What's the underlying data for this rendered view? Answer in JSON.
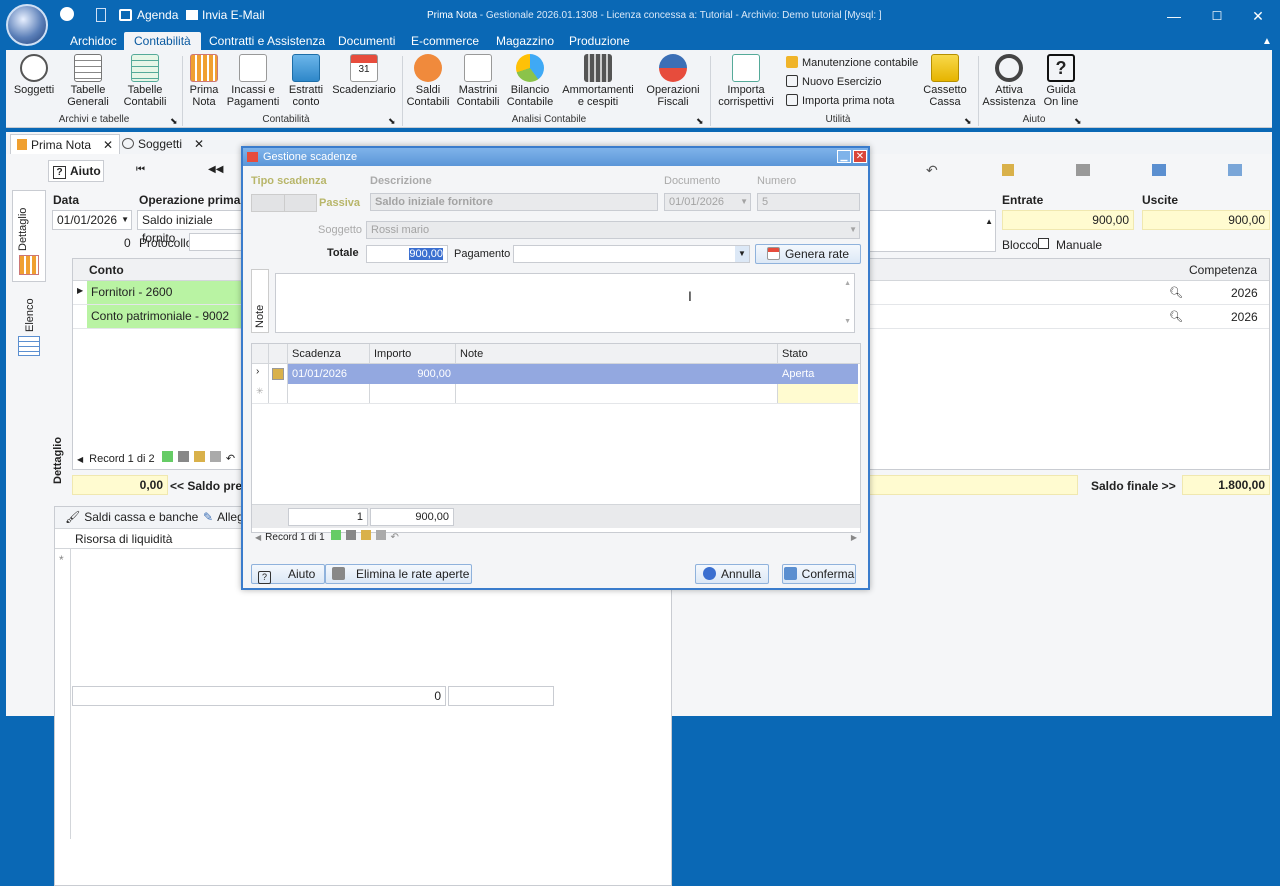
{
  "app": {
    "window_title_main": "Prima Nota",
    "window_title_rest": " - Gestionale 2026.01.1308 - Licenza concessa a: Tutorial - Archivio: Demo tutorial  [Mysql: ]",
    "quick_access": [
      "Agenda",
      "Invia E-Mail"
    ]
  },
  "menu_tabs": [
    "Archidoc",
    "Contabilità",
    "Contratti e Assistenza",
    "Documenti",
    "E-commerce",
    "Magazzino",
    "Produzione"
  ],
  "ribbon": {
    "soggetti": "Soggetti",
    "tabelle_generali": "Tabelle\nGenerali",
    "tabelle_contabili": "Tabelle\nContabili",
    "prima_nota": "Prima\nNota",
    "incassi_pagamenti": "Incassi e\nPagamenti",
    "estratti_conto": "Estratti\nconto",
    "scadenziario": "Scadenziario",
    "saldi_contabili": "Saldi\nContabili",
    "mastrini_contabili": "Mastrini\nContabili",
    "bilancio_contabile": "Bilancio\nContabile",
    "ammortamenti": "Ammortamenti\ne cespiti",
    "operazioni_fiscali": "Operazioni\nFiscali",
    "importa_corrispettivi": "Importa\ncorrispettivi",
    "manutenzione_contabile": "Manutenzione contabile",
    "nuovo_esercizio": "Nuovo Esercizio",
    "importa_prima_nota": "Importa prima nota",
    "cassetto_cassa": "Cassetto\nCassa",
    "attiva_assistenza": "Attiva\nAssistenza",
    "guida_online": "Guida\nOn line",
    "groups": [
      "Archivi e tabelle",
      "Contabilità",
      "Analisi Contabile",
      "Utilità",
      "Aiuto"
    ]
  },
  "doc_tabs": [
    "Prima Nota",
    "Soggetti"
  ],
  "main": {
    "aiuto": "Aiuto",
    "side_tabs": [
      "Dettaglio",
      "Elenco"
    ],
    "data_label": "Data",
    "data_value": "01/01/2026",
    "operazione_label": "Operazione prima n",
    "operazione_value": "Saldo iniziale fornito",
    "zero": "0",
    "protocollo_label": "Protocollo",
    "entrate_label": "Entrate",
    "uscite_label": "Uscite",
    "entrate_value": "900,00",
    "uscite_value": "900,00",
    "blocco_label": "Blocco",
    "manuale_label": "Manuale",
    "conto_header": "Conto",
    "competenza_header": "Competenza",
    "rows": [
      {
        "conto": "Fornitori - 2600",
        "competenza": "2026"
      },
      {
        "conto": "Conto patrimoniale - 9002",
        "competenza": "2026"
      }
    ],
    "dettaglio_vertical": "Dettaglio",
    "record_label": "Record 1 di 2",
    "saldo_iniziale_value": "0,00",
    "saldo_prec_label": "<< Saldo pre",
    "saldo_finale_label": "Saldo finale >>",
    "saldo_finale_value": "1.800,00",
    "bottom_tabs": [
      "Saldi cassa e banche",
      "Alleg"
    ],
    "risorsa_header": "Risorsa di liquidità",
    "bottom_total": "0"
  },
  "dialog": {
    "title": "Gestione scadenze",
    "tipo_scadenza_label": "Tipo scadenza",
    "passiva_label": "Passiva",
    "descrizione_label": "Descrizione",
    "descrizione_value": "Saldo iniziale fornitore",
    "documento_label": "Documento",
    "documento_value": "01/01/2026",
    "numero_label": "Numero",
    "numero_value": "5",
    "soggetto_label": "Soggetto",
    "soggetto_value": "Rossi mario",
    "totale_label": "Totale",
    "totale_value": "900,00",
    "pagamento_label": "Pagamento",
    "genera_rate": "Genera rate",
    "note_label": "Note",
    "grid_headers": [
      "Scadenza",
      "Importo",
      "Note",
      "Stato"
    ],
    "grid_row": {
      "scadenza": "01/01/2026",
      "importo": "900,00",
      "note": "",
      "stato": "Aperta"
    },
    "footer_count": "1",
    "footer_total": "900,00",
    "record_label": "Record 1 di 1",
    "btn_aiuto": "Aiuto",
    "btn_elimina": "Elimina le rate aperte",
    "btn_annulla": "Annulla",
    "btn_conferma": "Conferma"
  }
}
